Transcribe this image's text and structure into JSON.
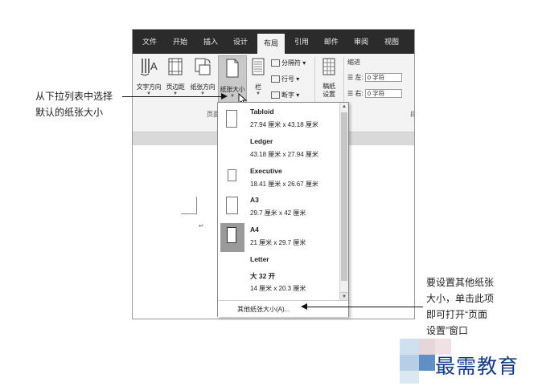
{
  "tabs": [
    "文件",
    "开始",
    "插入",
    "设计",
    "布局",
    "引用",
    "邮件",
    "审阅",
    "视图"
  ],
  "active_tab": "布局",
  "ribbon": {
    "buttons": [
      "文字方向",
      "页边距",
      "纸张方向",
      "纸张大小",
      "栏"
    ],
    "break_items": [
      "分隔符",
      "行号",
      "断字"
    ],
    "watermark_btn": [
      "稿纸",
      "设置"
    ],
    "group_labels": [
      "页面",
      "稿纸",
      "段"
    ],
    "indent": {
      "title": "缩进",
      "left_label": "左:",
      "right_label": "右:",
      "left_value": "0 字符",
      "right_value": "0 字符"
    }
  },
  "paper_sizes": [
    {
      "name": "Tabloid",
      "size": "27.94 厘米 x 43.18 厘米"
    },
    {
      "name": "Ledger",
      "size": "43.18 厘米 x 27.94 厘米"
    },
    {
      "name": "Executive",
      "size": "18.41 厘米 x 26.67 厘米"
    },
    {
      "name": "A3",
      "size": "29.7 厘米 x 42 厘米"
    },
    {
      "name": "A4",
      "size": "21 厘米 x 29.7 厘米"
    },
    {
      "name": "Letter",
      "size": ""
    },
    {
      "name": "大 32 开",
      "size": "14 厘米 x 20.3 厘米"
    }
  ],
  "more_sizes": "其他纸张大小(A)...",
  "annotations": {
    "left": [
      "从下拉列表中选择",
      "默认的纸张大小"
    ],
    "right": [
      "要设置其他纸张",
      "大小，单击此项",
      "即可打开“页面",
      "设置”窗口"
    ]
  },
  "brand": "最需教育",
  "colors": {
    "tabbar": "#2b2b2b",
    "ribbon": "#f3f3f3",
    "brand": "#143a8a"
  }
}
